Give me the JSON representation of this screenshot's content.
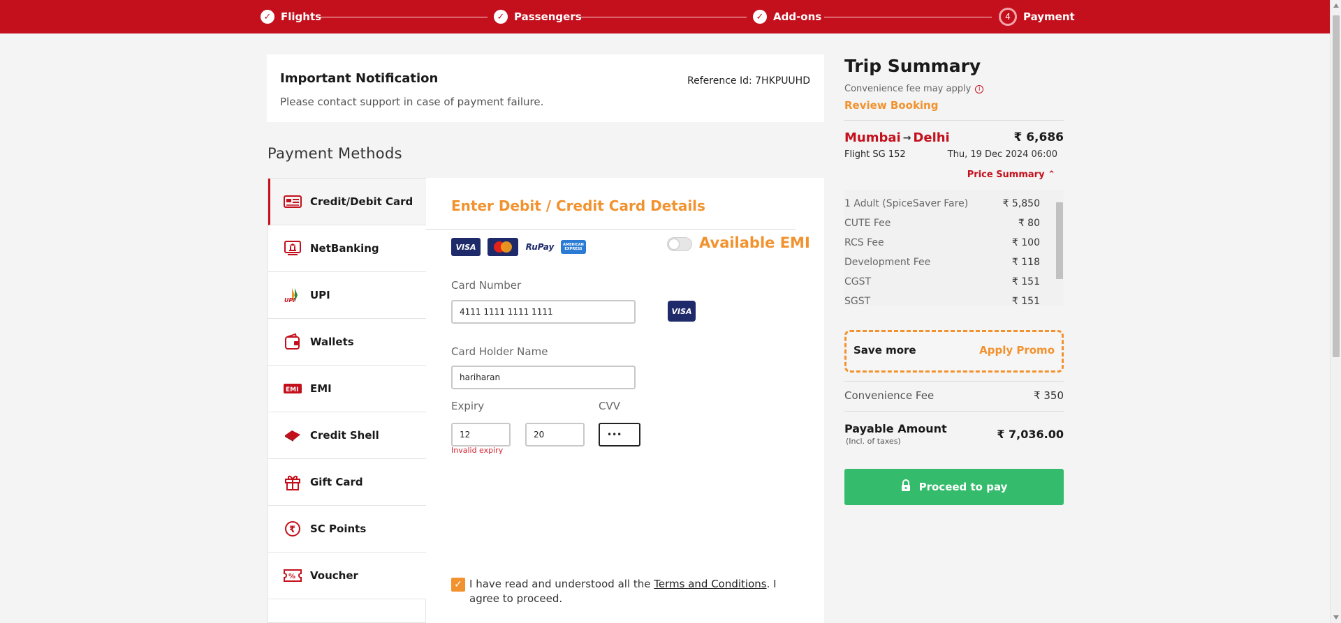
{
  "steps": [
    {
      "label": "Flights",
      "status": "done"
    },
    {
      "label": "Passengers",
      "status": "done"
    },
    {
      "label": "Add-ons",
      "status": "done"
    },
    {
      "label": "Payment",
      "number": "4",
      "status": "current"
    }
  ],
  "notification": {
    "title": "Important Notification",
    "message": "Please contact support in case of payment failure.",
    "reference": "Reference Id: 7HKPUUHD"
  },
  "payment_methods": {
    "title": "Payment Methods",
    "items": [
      {
        "label": "Credit/Debit Card",
        "icon": "card-icon",
        "active": true
      },
      {
        "label": "NetBanking",
        "icon": "bank-icon"
      },
      {
        "label": "UPI",
        "icon": "upi-icon"
      },
      {
        "label": "Wallets",
        "icon": "wallet-icon"
      },
      {
        "label": "EMI",
        "icon": "emi-icon"
      },
      {
        "label": "Credit Shell",
        "icon": "credit-shell-icon"
      },
      {
        "label": "Gift Card",
        "icon": "gift-icon"
      },
      {
        "label": "SC Points",
        "icon": "rupee-coin-icon"
      },
      {
        "label": "Voucher",
        "icon": "voucher-icon"
      }
    ]
  },
  "card_form": {
    "heading": "Enter Debit / Credit Card Details",
    "brands": [
      "VISA",
      "MasterCard",
      "RuPay",
      "AMERICAN EXPRESS"
    ],
    "emi_label": "Available EMI",
    "card_number_label": "Card Number",
    "card_number_value": "4111 1111 1111 1111",
    "detected_brand": "VISA",
    "holder_label": "Card Holder Name",
    "holder_value": "hariharan",
    "expiry_label": "Expiry",
    "expiry_month": "12",
    "expiry_year": "20",
    "expiry_error": "Invalid expiry",
    "cvv_label": "CVV",
    "cvv_value": "•••",
    "terms_prefix": "I have read and understood all the ",
    "terms_link": "Terms and Conditions",
    "terms_suffix": ". I agree to proceed.",
    "terms_checked": true
  },
  "summary": {
    "title": "Trip Summary",
    "convenience_note": "Convenience fee may apply",
    "review_link": "Review Booking",
    "origin": "Mumbai",
    "destination": "Delhi",
    "fare": "₹ 6,686",
    "flight": "Flight  SG 152",
    "date": "Thu, 19 Dec 2024 06:00",
    "price_summary_label": "Price Summary",
    "price_rows": [
      {
        "label": "1 Adult  (SpiceSaver Fare)",
        "value": "₹ 5,850"
      },
      {
        "label": "CUTE Fee",
        "value": "₹ 80"
      },
      {
        "label": "RCS Fee",
        "value": "₹ 100"
      },
      {
        "label": "Development Fee",
        "value": "₹ 118"
      },
      {
        "label": "CGST",
        "value": "₹ 151"
      },
      {
        "label": "SGST",
        "value": "₹ 151"
      }
    ],
    "promo_text": "Save more",
    "promo_link": "Apply Promo",
    "convenience_fee_label": "Convenience Fee",
    "convenience_fee_value": "₹ 350",
    "payable_label": "Payable Amount",
    "payable_sub": "(Incl. of taxes)",
    "payable_value": "₹ 7,036.00",
    "proceed_label": "Proceed to pay"
  },
  "colors": {
    "brand_red": "#c4101c",
    "accent_orange": "#f2922e",
    "pay_green": "#34bc6c"
  }
}
